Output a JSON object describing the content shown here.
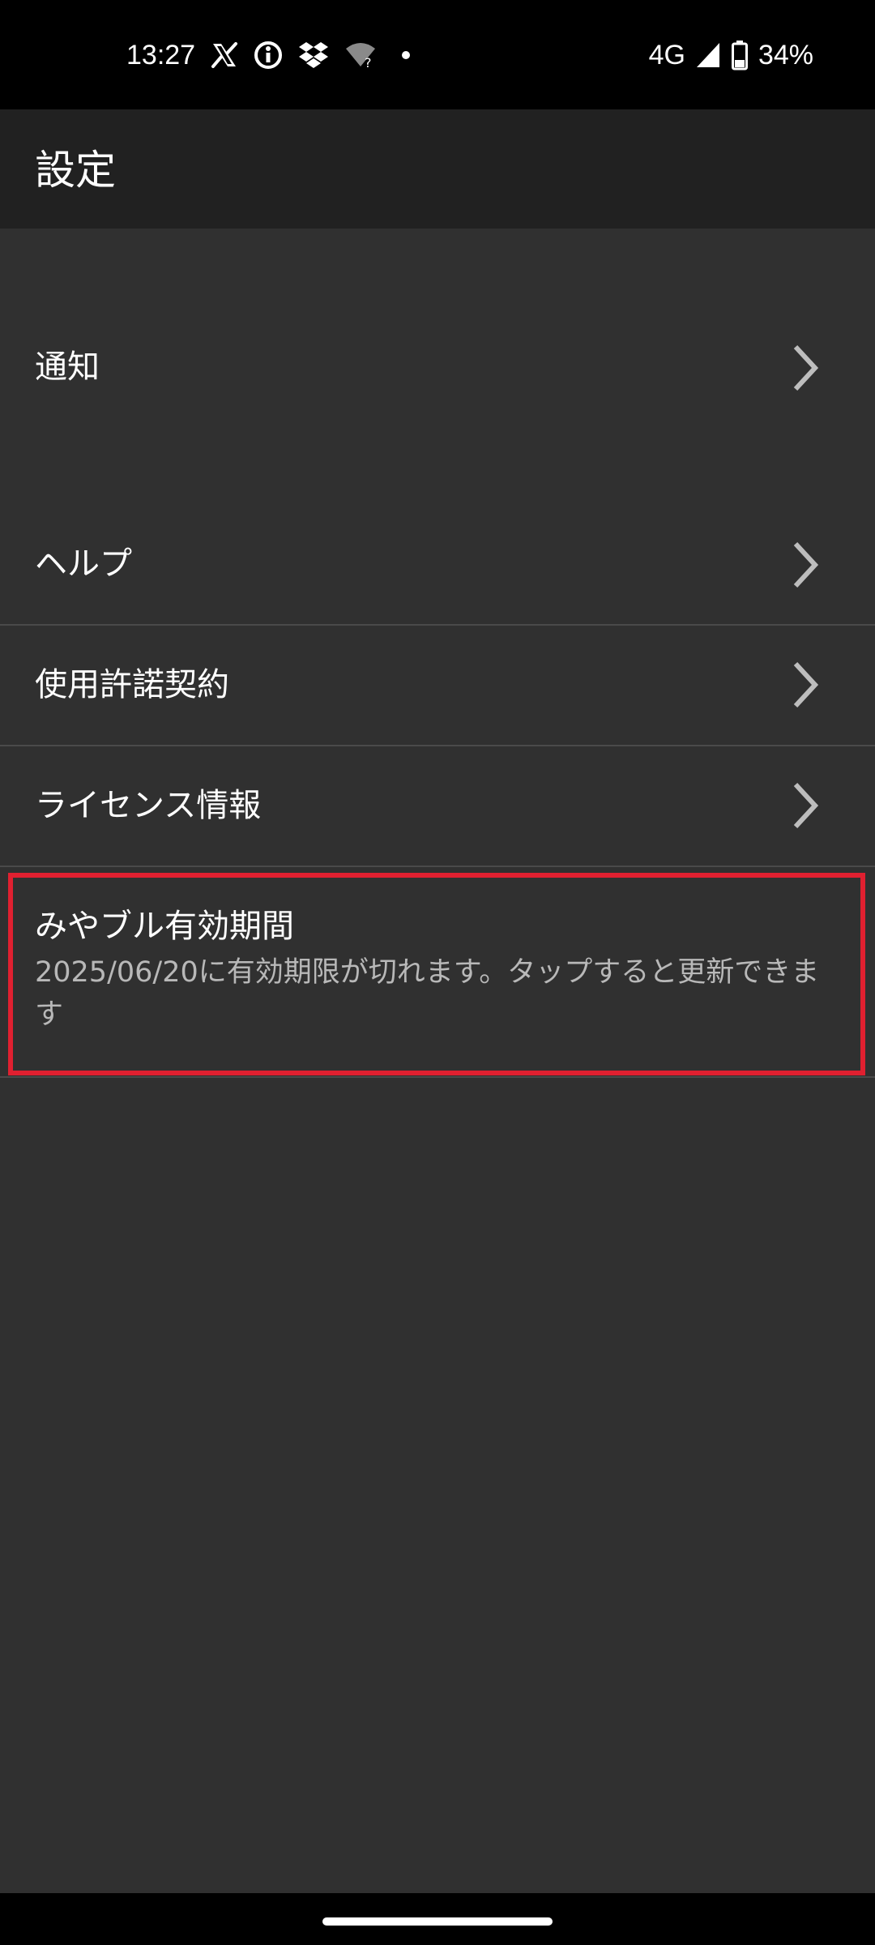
{
  "status_bar": {
    "time": "13:27",
    "network": "4G",
    "battery": "34%",
    "left_icons": [
      "x-icon",
      "info-icon",
      "dropbox-icon",
      "wifi-unknown-icon",
      "dot-icon"
    ],
    "right_icons": [
      "signal-icon",
      "battery-icon"
    ]
  },
  "toolbar": {
    "title": "設定"
  },
  "settings": {
    "notifications": "通知",
    "help": "ヘルプ",
    "license_agreement": "使用許諾契約",
    "license_info": "ライセンス情報",
    "subscription": {
      "title": "みやブル有効期間",
      "description": "2025/06/20に有効期限が切れます。タップすると更新できます"
    }
  },
  "colors": {
    "background": "#303030",
    "toolbar": "#212121",
    "highlight": "#e02030",
    "divider": "#4a4a4a"
  }
}
